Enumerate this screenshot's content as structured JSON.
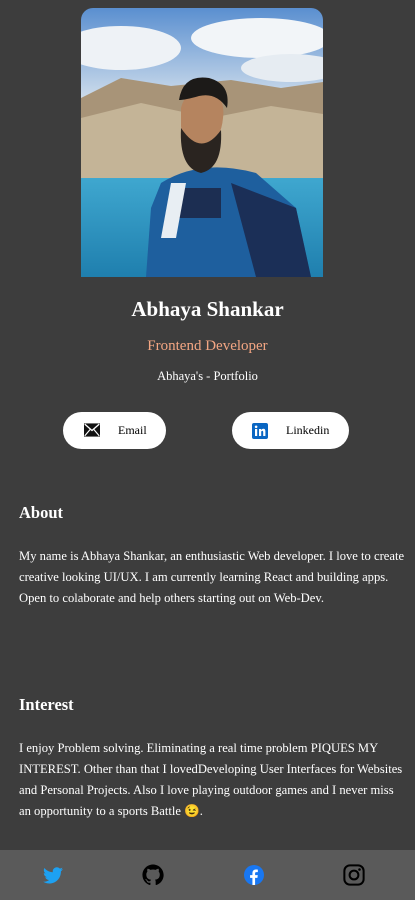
{
  "profile": {
    "name": "Abhaya Shankar",
    "role": "Frontend Developer",
    "portfolio": "Abhaya's - Portfolio"
  },
  "buttons": {
    "email": "Email",
    "linkedin": "Linkedin"
  },
  "about": {
    "title": "About",
    "text": "My name is Abhaya Shankar, an enthusiastic Web developer. I love to create creative looking UI/UX. I am currently learning React and building apps. Open to colaborate and help others starting out on Web-Dev."
  },
  "interest": {
    "title": "Interest",
    "text": "I enjoy Problem solving. Eliminating a real time problem PIQUES MY INTEREST. Other than that I lovedDeveloping User Interfaces for Websites and Personal Projects. Also I love playing outdoor games and I never miss an opportunity to a sports Battle 😉."
  },
  "footer": {
    "icons": [
      "twitter-icon",
      "github-icon",
      "facebook-icon",
      "instagram-icon"
    ]
  },
  "colors": {
    "background": "#3d3d3d",
    "footer": "#5a5a5a",
    "role_accent": "#f3a683",
    "twitter": "#1da1f2",
    "facebook": "#1877f2",
    "linkedin": "#0a66c2"
  }
}
